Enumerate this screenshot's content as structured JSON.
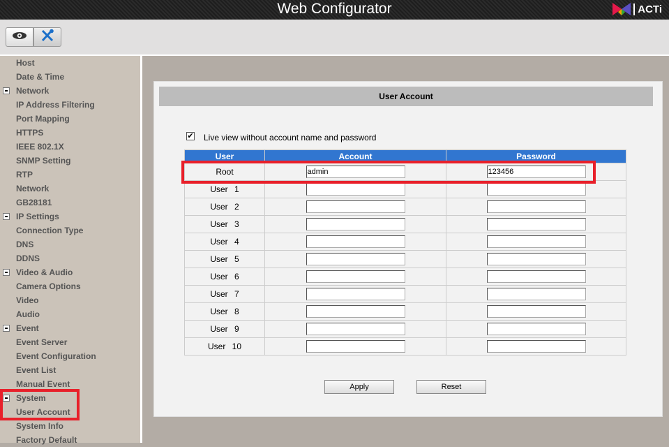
{
  "header": {
    "title": "Web Configurator",
    "logo_text": "ACTi"
  },
  "toolbar": {
    "view_icon": "eye-icon",
    "setup_icon": "tools-icon"
  },
  "sidebar": {
    "items": [
      {
        "label": "Host",
        "group": false
      },
      {
        "label": "Date & Time",
        "group": false
      },
      {
        "label": "Network",
        "group": true
      },
      {
        "label": "IP Address Filtering",
        "group": false
      },
      {
        "label": "Port Mapping",
        "group": false
      },
      {
        "label": "HTTPS",
        "group": false
      },
      {
        "label": "IEEE 802.1X",
        "group": false
      },
      {
        "label": "SNMP Setting",
        "group": false
      },
      {
        "label": "RTP",
        "group": false
      },
      {
        "label": "Network",
        "group": false
      },
      {
        "label": "GB28181",
        "group": false
      },
      {
        "label": "IP Settings",
        "group": true
      },
      {
        "label": "Connection Type",
        "group": false
      },
      {
        "label": "DNS",
        "group": false
      },
      {
        "label": "DDNS",
        "group": false
      },
      {
        "label": "Video & Audio",
        "group": true
      },
      {
        "label": "Camera Options",
        "group": false
      },
      {
        "label": "Video",
        "group": false
      },
      {
        "label": "Audio",
        "group": false
      },
      {
        "label": "Event",
        "group": true
      },
      {
        "label": "Event Server",
        "group": false
      },
      {
        "label": "Event Configuration",
        "group": false
      },
      {
        "label": "Event List",
        "group": false
      },
      {
        "label": "Manual Event",
        "group": false
      },
      {
        "label": "System",
        "group": true
      },
      {
        "label": "User Account",
        "group": false
      },
      {
        "label": "System Info",
        "group": false
      },
      {
        "label": "Factory Default",
        "group": false
      }
    ]
  },
  "main": {
    "title": "User Account",
    "live_view_label": "Live view without account name and password",
    "live_view_checked": true,
    "columns": [
      "User",
      "Account",
      "Password"
    ],
    "rows": [
      {
        "user": "Root",
        "account": "admin",
        "password": "123456"
      },
      {
        "user": "User 1",
        "account": "",
        "password": ""
      },
      {
        "user": "User 2",
        "account": "",
        "password": ""
      },
      {
        "user": "User 3",
        "account": "",
        "password": ""
      },
      {
        "user": "User 4",
        "account": "",
        "password": ""
      },
      {
        "user": "User 5",
        "account": "",
        "password": ""
      },
      {
        "user": "User 6",
        "account": "",
        "password": ""
      },
      {
        "user": "User 7",
        "account": "",
        "password": ""
      },
      {
        "user": "User 8",
        "account": "",
        "password": ""
      },
      {
        "user": "User 9",
        "account": "",
        "password": ""
      },
      {
        "user": "User 10",
        "account": "",
        "password": ""
      }
    ],
    "apply_label": "Apply",
    "reset_label": "Reset"
  },
  "colors": {
    "highlight": "#e8202a",
    "table_header": "#3176d0"
  }
}
